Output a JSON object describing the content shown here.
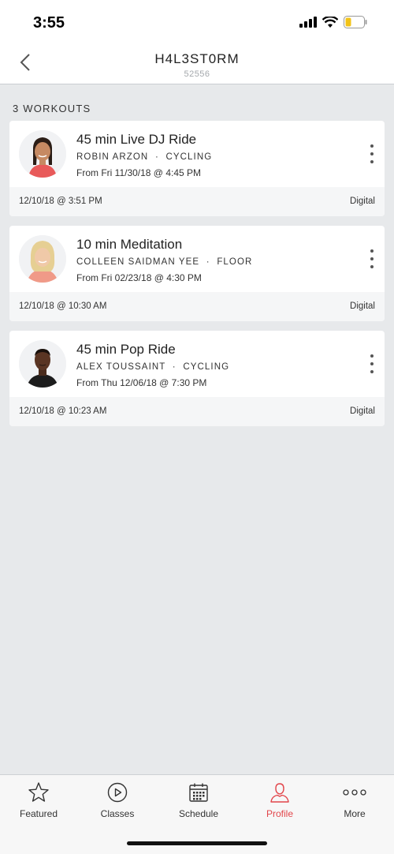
{
  "status_bar": {
    "time": "3:55"
  },
  "header": {
    "title": "H4L3ST0RM",
    "subtitle": "52556"
  },
  "section_label": "3 WORKOUTS",
  "workouts": [
    {
      "title": "45 min Live DJ Ride",
      "instructor": "ROBIN ARZON",
      "separator": "·",
      "discipline": "CYCLING",
      "from": "From Fri 11/30/18 @ 4:45 PM",
      "completed": "12/10/18 @ 3:51 PM",
      "platform": "Digital"
    },
    {
      "title": "10 min Meditation",
      "instructor": "COLLEEN SAIDMAN YEE",
      "separator": "·",
      "discipline": "FLOOR",
      "from": "From Fri 02/23/18 @ 4:30 PM",
      "completed": "12/10/18 @ 10:30 AM",
      "platform": "Digital"
    },
    {
      "title": "45 min Pop Ride",
      "instructor": "ALEX TOUSSAINT",
      "separator": "·",
      "discipline": "CYCLING",
      "from": "From Thu 12/06/18 @ 7:30 PM",
      "completed": "12/10/18 @ 10:23 AM",
      "platform": "Digital"
    }
  ],
  "tabs": [
    {
      "label": "Featured",
      "icon": "star-icon"
    },
    {
      "label": "Classes",
      "icon": "play-circle-icon"
    },
    {
      "label": "Schedule",
      "icon": "calendar-icon"
    },
    {
      "label": "Profile",
      "icon": "person-icon",
      "active": true
    },
    {
      "label": "More",
      "icon": "more-dots-icon"
    }
  ],
  "colors": {
    "accent": "#e2454a",
    "background": "#e7e9eb",
    "card": "#ffffff"
  }
}
